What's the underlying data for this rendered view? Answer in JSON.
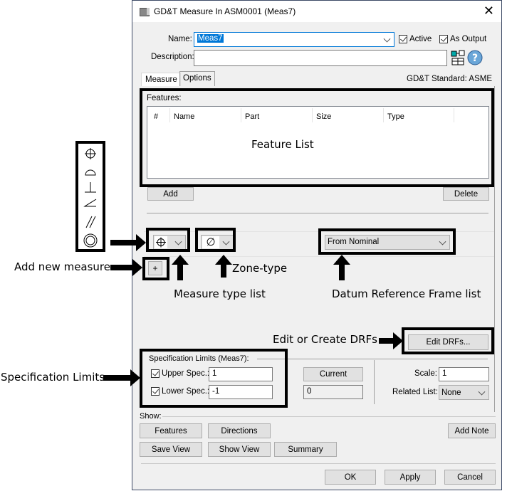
{
  "window": {
    "title": "GD&T Measure In ASM0001 (Meas7)"
  },
  "form": {
    "name_label": "Name:",
    "name_value": "Meas7",
    "active_label": "Active",
    "active_checked": true,
    "as_output_label": "As Output",
    "as_output_checked": true,
    "description_label": "Description:",
    "description_value": ""
  },
  "tabs": [
    {
      "label": "Measure",
      "active": true
    },
    {
      "label": "Options",
      "active": false
    }
  ],
  "standard": "GD&T Standard: ASME",
  "features": {
    "label": "Features:",
    "columns": [
      "#",
      "Name",
      "Part",
      "Size",
      "Type"
    ],
    "rows": [],
    "add_label": "Add",
    "delete_label": "Delete"
  },
  "measure": {
    "type_symbol": "⌖",
    "zone_symbol": "∅",
    "add_symbol": "+",
    "drf_value": "From Nominal",
    "edit_drfs_label": "Edit DRFs..."
  },
  "spec": {
    "title": "Specification Limits (Meas7):",
    "upper_label": "Upper Spec.:",
    "upper_value": "1",
    "upper_checked": true,
    "lower_label": "Lower Spec.:",
    "lower_value": "-1",
    "lower_checked": true,
    "current_label": "Current",
    "current_value": "0",
    "scale_label": "Scale:",
    "scale_value": "1",
    "related_label": "Related List:",
    "related_value": "None"
  },
  "show": {
    "label": "Show:",
    "features": "Features",
    "directions": "Directions",
    "add_note": "Add Note",
    "save_view": "Save View",
    "show_view": "Show View",
    "summary": "Summary"
  },
  "footer": {
    "ok": "OK",
    "apply": "Apply",
    "cancel": "Cancel"
  },
  "annotations": {
    "feature_list": "Feature List",
    "add_new_measure": "Add new measure",
    "zone_type": "Zone-type",
    "measure_type_list": "Measure type list",
    "drf_list": "Datum Reference Frame list",
    "edit_create_drfs": "Edit or Create DRFs",
    "spec_limits": "Specification Limits",
    "symbols": [
      "⌖",
      "◠",
      "⊥",
      "∠",
      "//",
      "◎"
    ]
  }
}
